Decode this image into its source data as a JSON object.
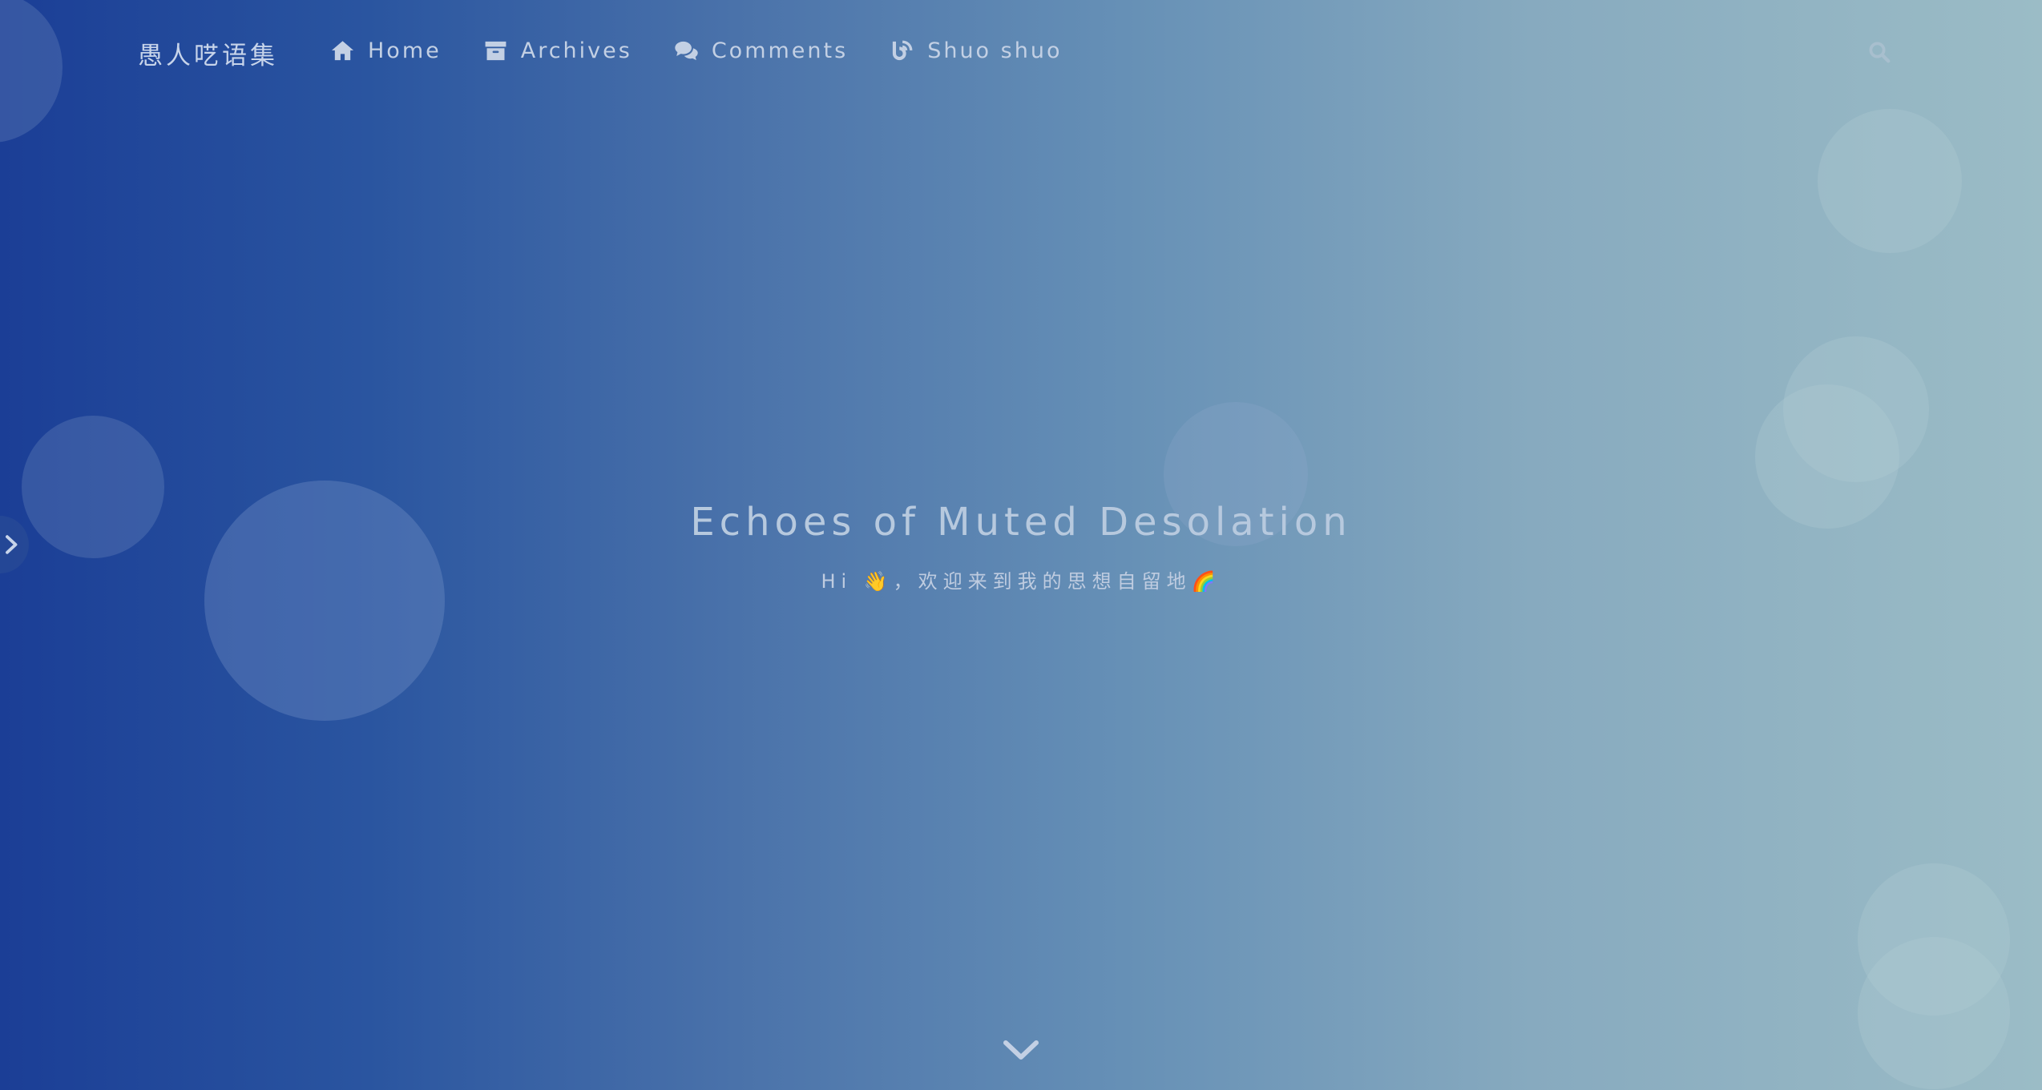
{
  "site": {
    "title": "愚人呓语集"
  },
  "nav": {
    "items": [
      {
        "label": "Home",
        "icon": "home-icon"
      },
      {
        "label": "Archives",
        "icon": "archive-icon"
      },
      {
        "label": "Comments",
        "icon": "comments-icon"
      },
      {
        "label": "Shuo shuo",
        "icon": "blog-icon"
      }
    ],
    "search_icon": "search-icon"
  },
  "hero": {
    "title": "Echoes of Muted Desolation",
    "subtitle": "Hi 👋，欢迎来到我的思想自留地🌈"
  },
  "controls": {
    "side_toggle_icon": "chevron-right-icon",
    "scroll_down_icon": "chevron-down-icon"
  },
  "colors": {
    "gradient_start": "#1b3e96",
    "gradient_end": "#9bbcc6",
    "text": "#c3d0e4"
  }
}
